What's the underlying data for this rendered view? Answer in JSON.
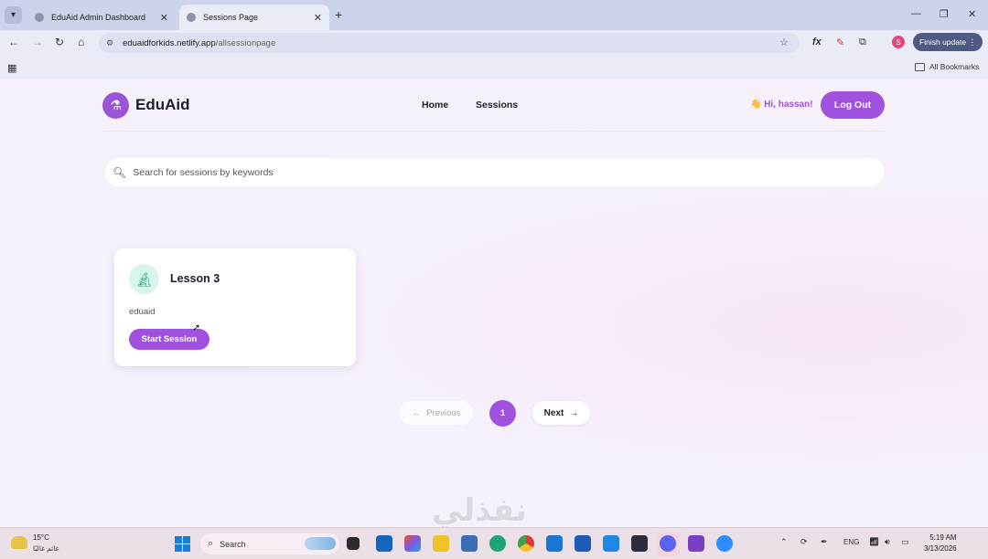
{
  "browser": {
    "tabs": [
      {
        "title": "EduAid Admin Dashboard",
        "active": false
      },
      {
        "title": "Sessions Page",
        "active": true
      }
    ],
    "new_tab_symbol": "+",
    "url_host": "eduaidforkids.netlify.app",
    "url_path": "/allsessionpage",
    "finish_update_label": "Finish update",
    "profile_initial": "S",
    "all_bookmarks_label": "All Bookmarks"
  },
  "header": {
    "brand": "EduAid",
    "nav": [
      {
        "label": "Home"
      },
      {
        "label": "Sessions"
      }
    ],
    "greeting": "👋 Hi, hassan!",
    "logout_label": "Log Out"
  },
  "search": {
    "placeholder": "Search for sessions by keywords",
    "value": ""
  },
  "sessions": [
    {
      "title": "Lesson 3",
      "author": "eduaid",
      "action_label": "Start Session",
      "icon": "microscope-icon"
    }
  ],
  "pagination": {
    "previous_label": "Previous",
    "current_page": "1",
    "next_label": "Next"
  },
  "watermark": "نفذلي",
  "taskbar": {
    "temperature": "15°C",
    "weather_location": "غائم غالبًا",
    "search_label": "Search",
    "language": "ENG",
    "time": "5:19 AM",
    "date": "3/13/2026"
  },
  "colors": {
    "accent": "#a052de",
    "brand_circle": "#9a55d6",
    "page_bg": "#f5f0fa",
    "tabbar_bg": "#cdd3ea"
  }
}
